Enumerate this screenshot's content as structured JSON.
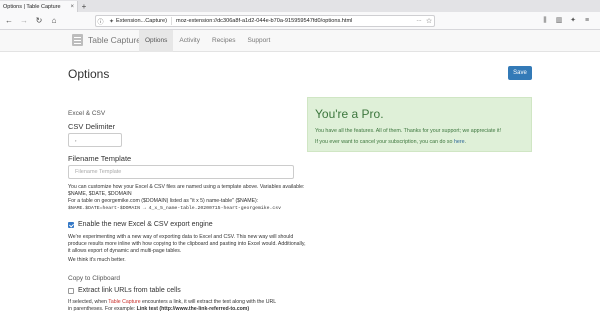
{
  "browser": {
    "tab_title": "Options | Table Capture",
    "tab_close": "×",
    "new_tab": "+",
    "back": "←",
    "forward": "→",
    "reload": "↻",
    "home": "⌂",
    "url_info": "ⓘ",
    "extension_label": "Extension...Capture)",
    "url": "moz-extension://dc306a8f-a1d2-044e-b70a-915959547fd0/options.html",
    "url_more": "···",
    "url_star": "☆",
    "library_icon": "⫼",
    "sidebar_icon": "▥",
    "extensions_icon": "✦",
    "menu_icon": "≡"
  },
  "app": {
    "brand": "Table Capture",
    "nav": [
      {
        "label": "Options",
        "active": true
      },
      {
        "label": "Activity",
        "active": false
      },
      {
        "label": "Recipes",
        "active": false
      },
      {
        "label": "Support",
        "active": false
      }
    ]
  },
  "page": {
    "title": "Options",
    "save_label": "Save",
    "excel_section": "Excel & CSV",
    "csv_delimiter_label": "CSV Delimiter",
    "csv_delimiter_value": ",",
    "filename_template_label": "Filename Template",
    "filename_template_placeholder": "Filename Template",
    "filename_help_1": "You can customize how your Excel & CSV files are named using a template above. Variables available: $NAME, $DATE, $DOMAIN",
    "filename_help_2": "For a table on georgemike.com ($DOMAIN) listed as \"it x 5) name-table\" ($NAME):",
    "filename_help_3": "$NAME.$DATE=heart-$DOMAIN → 4_x_5_name-table.20200715-heart-georgemike.csv",
    "new_export_label": "Enable the new Excel & CSV export engine",
    "new_export_checked": true,
    "new_export_help": "We're experimenting with a new way of exporting data to Excel and CSV. This new way will should produce results more inline with how copying to the clipboard and pasting into Excel would. Additionally, it allows export of dynamic and multi-page tables.",
    "new_export_help_2": "We think it's much better.",
    "copy_section": "Copy to Clipboard",
    "extract_links_label": "Extract link URLs from table cells",
    "extract_links_checked": false,
    "extract_help_1a": "If selected, when ",
    "extract_help_1b": "Table Capture",
    "extract_help_1c": " encounters a link, it will extract the text along with the URL",
    "extract_help_2a": "in parentheses. For example: ",
    "extract_help_2b": "Link test (http://www.the-link-referred-to.com)"
  },
  "pro": {
    "title": "You're a Pro.",
    "line1": "You have all the features. All of them. Thanks for your support; we appreciate it!",
    "line2a": "If you ever want to cancel your subscription, you can do so ",
    "line2_link": "here",
    "line2b": "."
  },
  "colors": {
    "primary": "#337ab7",
    "pro_bg": "#dff0d8",
    "pro_text": "#3c763d"
  }
}
